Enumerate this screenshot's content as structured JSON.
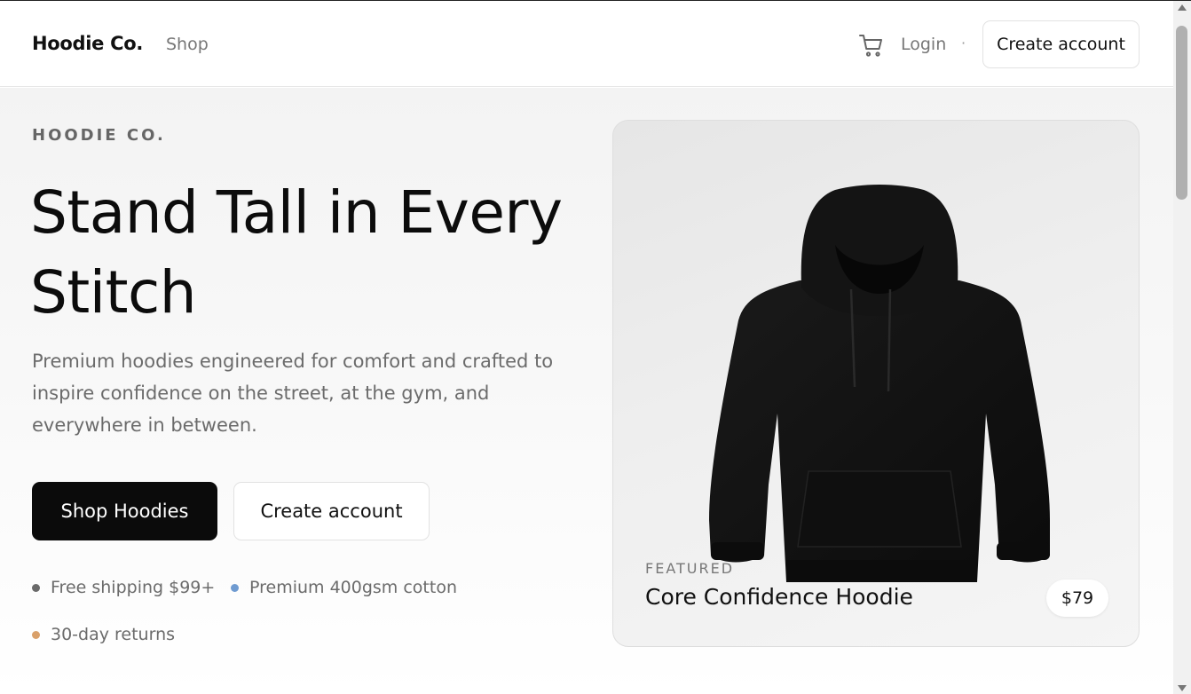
{
  "header": {
    "brand": "Hoodie Co.",
    "nav_shop": "Shop",
    "cart_icon": "shopping-cart-icon",
    "login": "Login",
    "separator": "·",
    "create_account": "Create account"
  },
  "hero": {
    "eyebrow": "HOODIE CO.",
    "headline_line1": "Stand Tall in Every",
    "headline_line2": "Stitch",
    "subtext": "Premium hoodies engineered for comfort and crafted to inspire confidence on the street, at the gym, and everywhere in between.",
    "primary_cta": "Shop Hoodies",
    "secondary_cta": "Create account",
    "features": [
      {
        "label": "Free shipping $99+",
        "color": "#6a6a6a"
      },
      {
        "label": "Premium 400gsm cotton",
        "color": "#6f9bd1"
      },
      {
        "label": "30-day returns",
        "color": "#d9a06a"
      }
    ]
  },
  "featured": {
    "eyebrow": "FEATURED",
    "title": "Core Confidence Hoodie",
    "price": "$79",
    "image_icon": "black-hoodie-image"
  },
  "colors": {
    "primary_button": "#0b0b0b",
    "muted_text": "#6b6b6b",
    "border": "#e2e2e2"
  }
}
